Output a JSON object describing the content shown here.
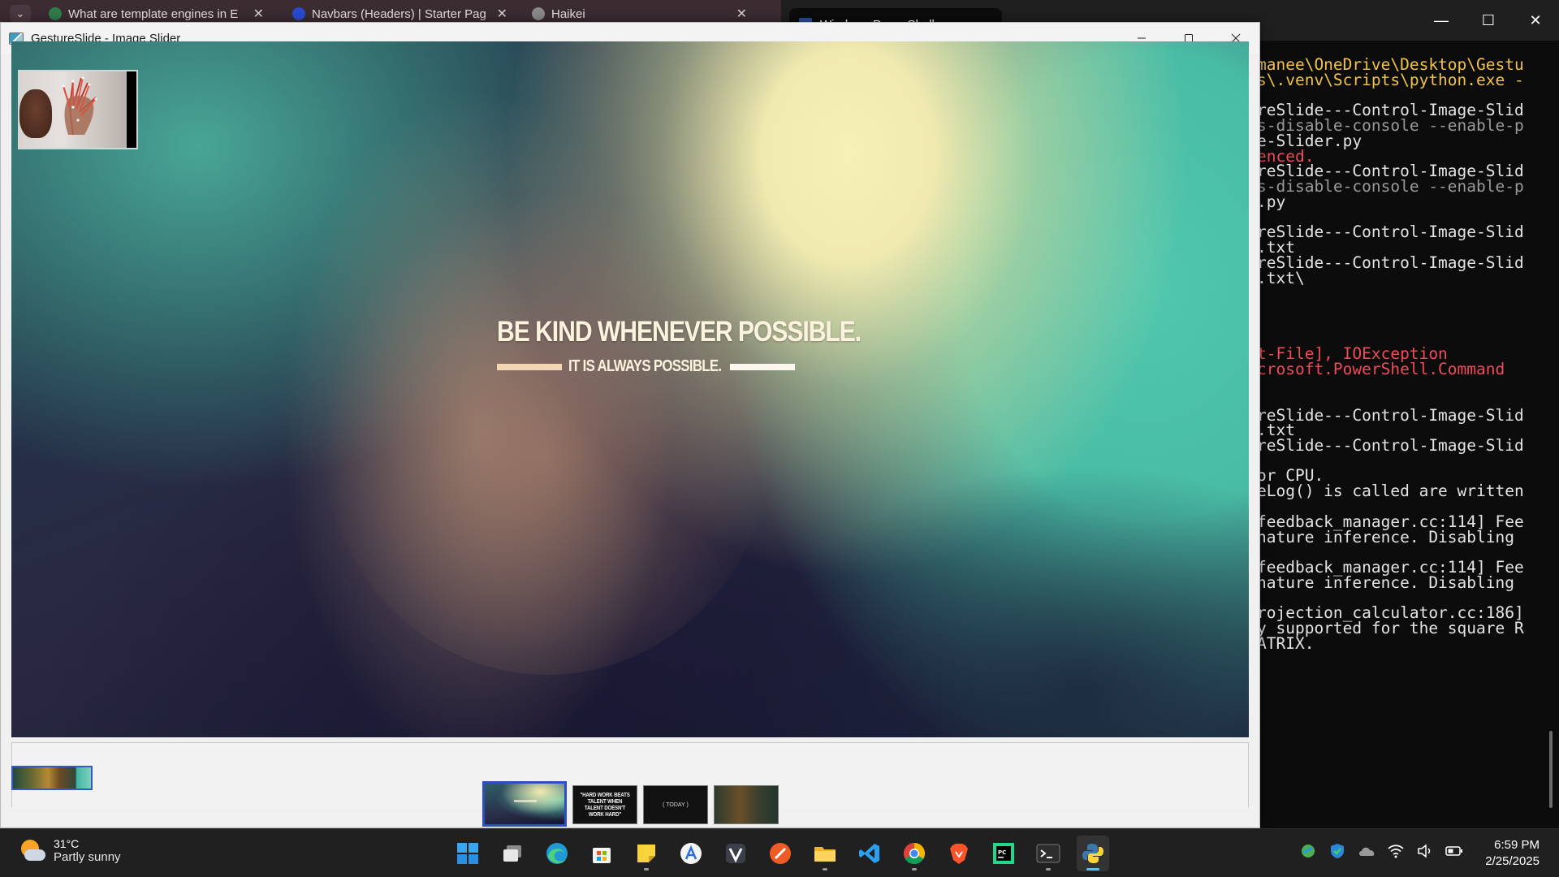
{
  "browser": {
    "tabs": [
      {
        "label": "What are template engines in E"
      },
      {
        "label": "Navbars (Headers) | Starter Pag"
      },
      {
        "label": "Haikei"
      }
    ]
  },
  "terminal": {
    "tab_label": "Windows PowerShell",
    "lines": [
      {
        "text": "manee\\OneDrive\\Desktop\\Gestu",
        "color": "yellow"
      },
      {
        "text": "s\\.venv\\Scripts\\python.exe -",
        "color": "yellow"
      },
      {
        "text": "reSlide---Control-Image-Slid",
        "color": "white"
      },
      {
        "text": "s-disable-console --enable-p",
        "color": "gray"
      },
      {
        "text": "e-Slider.py",
        "color": "white"
      },
      {
        "text": "enced.",
        "color": "red"
      },
      {
        "text": "reSlide---Control-Image-Slid",
        "color": "white"
      },
      {
        "text": "s-disable-console --enable-p",
        "color": "gray"
      },
      {
        "text": ".py",
        "color": "white"
      },
      {
        "text": "reSlide---Control-Image-Slid",
        "color": "white"
      },
      {
        "text": ".txt",
        "color": "white"
      },
      {
        "text": "reSlide---Control-Image-Slid",
        "color": "white"
      },
      {
        "text": ".txt\\",
        "color": "white"
      },
      {
        "text": "t-File], IOException",
        "color": "red"
      },
      {
        "text": "crosoft.PowerShell.Command",
        "color": "red"
      },
      {
        "text": "reSlide---Control-Image-Slid",
        "color": "white"
      },
      {
        "text": ".txt",
        "color": "white"
      },
      {
        "text": "reSlide---Control-Image-Slid",
        "color": "white"
      },
      {
        "text": "or CPU.",
        "color": "white"
      },
      {
        "text": "eLog() is called are written",
        "color": "white"
      },
      {
        "text": "feedback_manager.cc:114] Fee",
        "color": "white"
      },
      {
        "text": "nature inference. Disabling",
        "color": "white"
      },
      {
        "text": "feedback_manager.cc:114] Fee",
        "color": "white"
      },
      {
        "text": "nature inference. Disabling",
        "color": "white"
      },
      {
        "text": "rojection_calculator.cc:186]",
        "color": "white"
      },
      {
        "text": "y supported for the square R",
        "color": "white"
      },
      {
        "text": "ATRIX.",
        "color": "white"
      }
    ]
  },
  "app": {
    "title": "GestureSlide - Image Slider",
    "slide": {
      "quote_main": "BE KIND WHENEVER POSSIBLE.",
      "quote_sub": "IT IS ALWAYS POSSIBLE."
    },
    "thumbnails": [
      {
        "caption": ""
      },
      {
        "caption": "\"HARD WORK BEATS TALENT WHEN TALENT DOESN'T WORK HARD\""
      },
      {
        "caption": "( TODAY )"
      },
      {
        "caption": ""
      }
    ],
    "active_thumbnail": 0
  },
  "taskbar": {
    "weather_temp": "31°C",
    "weather_desc": "Partly sunny",
    "apps": [
      "start",
      "task-view",
      "edge",
      "store",
      "sticky-notes",
      "app-store",
      "vectorize",
      "postman",
      "file-explorer",
      "vscode",
      "chrome",
      "brave",
      "pycharm",
      "terminal",
      "python"
    ],
    "time": "6:59 PM",
    "date": "2/25/2025"
  }
}
